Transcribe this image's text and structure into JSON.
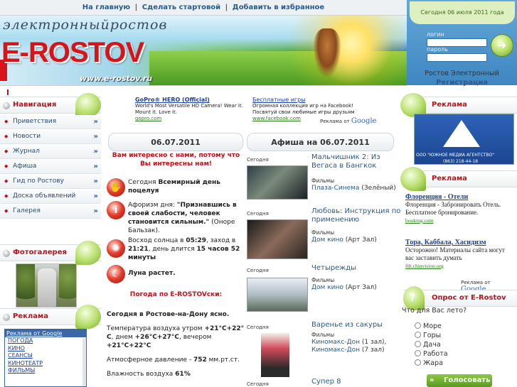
{
  "topnav": {
    "home": "На главную",
    "sep1": "|",
    "make_start": "Сделать стартовой",
    "sep2": "|",
    "bookmark": "Добавить в избранное"
  },
  "banner": {
    "cursive": "электронныйростов",
    "logo": "E-ROSTOV",
    "url": "www.e-rostov.ru"
  },
  "login": {
    "date": "Сегодня 06 июля 2011 года",
    "login_label": "логин",
    "password_label": "пароль",
    "go_icon": "arrow-right-icon"
  },
  "site_box": {
    "name": "Ростов Электронный",
    "register": "Регистрация"
  },
  "nav": {
    "title": "Навигация",
    "items": [
      {
        "label": "Приветствия",
        "arrow": "»"
      },
      {
        "label": "Новости",
        "arrow": "»"
      },
      {
        "label": "Журнал",
        "arrow": "»"
      },
      {
        "label": "Афиша",
        "arrow": "»"
      },
      {
        "label": "Гид по Ростову",
        "arrow": "»"
      },
      {
        "label": "Доска объявлений",
        "arrow": "»"
      },
      {
        "label": "Галерея",
        "arrow": "»"
      }
    ]
  },
  "photo_gallery": {
    "title": "Фотогалерея"
  },
  "ads_left": {
    "title": "Реклама",
    "header": "Реклама от Google",
    "links": [
      "ПОГОДА",
      "КИНО",
      "СЕАНСЫ",
      "КИНОТЕАТР",
      "ФИЛЬМЫ"
    ]
  },
  "sponsored": [
    {
      "title": "GoPro® HERO (Official)",
      "text": "World's Most Versatile HD Camera! Wear it. Mount it. Love it.",
      "url": "gopro.com"
    },
    {
      "title": "Бесплатные игры",
      "text": "Огромная коллекция игр на Facebook! Посвятуй свои любимые игры друзьям",
      "url": "www.facebook.com"
    }
  ],
  "google_badge": {
    "prefix": "Реклама от",
    "brand": "Google"
  },
  "today": {
    "date_tab": "06.07.2011",
    "intro": "Вам интересно с нами, потому что Вы интересны нам!",
    "holiday_prefix": "Сегодня",
    "holiday": "Всемирный день поцелуя",
    "aphorism_prefix": "Афоризм дня:",
    "aphorism": "\"Признавшись в своей слабости, человек становится сильным.\"",
    "aphorism_author": "(Оноре Бальзак).",
    "sun_text_1": "Восход солнца в",
    "sunrise": "05:29",
    "sun_text_2": ", заход в",
    "sunset": "21:21",
    "sun_text_3": ", день длится",
    "day_length": "15 часов 52 минуты",
    "moon": "Луна растет.",
    "weather_title": "Погода по E-ROSTOVски:",
    "weather_today": "Сегодня в Ростове-на-Дону ясно.",
    "temp_text_1": "Температура воздуха утром",
    "temp_morning": "+21°C+22° C",
    "temp_text_2": ", днем",
    "temp_day": "+26°C+27°C",
    "temp_text_3": ", вечером",
    "temp_evening": "+21°C+22°C",
    "pressure_text": "Атмосферное давление -",
    "pressure": "752",
    "pressure_unit": "мм.рт.ст.",
    "humidity_text": "Влажность воздуха",
    "humidity": "61%",
    "icons": {
      "kiss": "kiss-icon",
      "info": "info-icon",
      "sun": "sun-icon",
      "moon": "moon-icon"
    }
  },
  "afisha": {
    "tab": "Афиша на 06.07.2011",
    "items": [
      {
        "date": "Сегодня",
        "title": "Мальчишник 2: Из Вегаса в Бангкок",
        "category": "Фильмы",
        "place": "Плаза-Синема",
        "place_note": "(Зелёный)"
      },
      {
        "date": "Сегодня",
        "title": "Любовь: Инструкция по применению",
        "category": "Фильмы",
        "place": "Дом кино",
        "place_note": "(Арт Зал)"
      },
      {
        "date": "Сегодня",
        "title": "Четырежды",
        "category": "Фильмы",
        "place": "Дом кино",
        "place_note": "(Арт Зал)"
      },
      {
        "date": "Сегодня",
        "title": "Варенье из сакуры",
        "category": "Фильмы",
        "place": "Киномакс-Дон",
        "place_note": "(1 зал),",
        "place2": "Киномакс-Дон",
        "place2_note": "(7 зал)"
      },
      {
        "date": "Сегодня",
        "title": "Супер 8"
      }
    ]
  },
  "right": {
    "ads_title_1": "Реклама",
    "banner_text": "ООО \"ЮЖНОЕ МЕДИА АГЕНТСТВО\"",
    "banner_phone": "(863) 218-44-18",
    "ads_title_2": "Реклама",
    "google_ads": [
      {
        "title": "Флоренция - Отели",
        "text": "Флоренция - Забронировать Отель. Бесплатное бронирование.",
        "url": "booking.com"
      },
      {
        "title": "Тора, Каббала, Хасидизм",
        "text": "Осторожно! Материалы сайта могут вас заставить думать",
        "url": "ftlt.chinvision.org"
      }
    ],
    "poll_title": "Опрос от E-Rostov",
    "poll_question": "Что для Вас лето?",
    "poll_options": [
      "Море",
      "Горы",
      "Дача",
      "Работа",
      "Жара"
    ],
    "vote_label": "Голосовать"
  },
  "colors": {
    "accent_red": "#c0111a",
    "link_blue": "#2a5a8c",
    "green": "#7ab03a",
    "blue_panel": "#3f86c2"
  }
}
